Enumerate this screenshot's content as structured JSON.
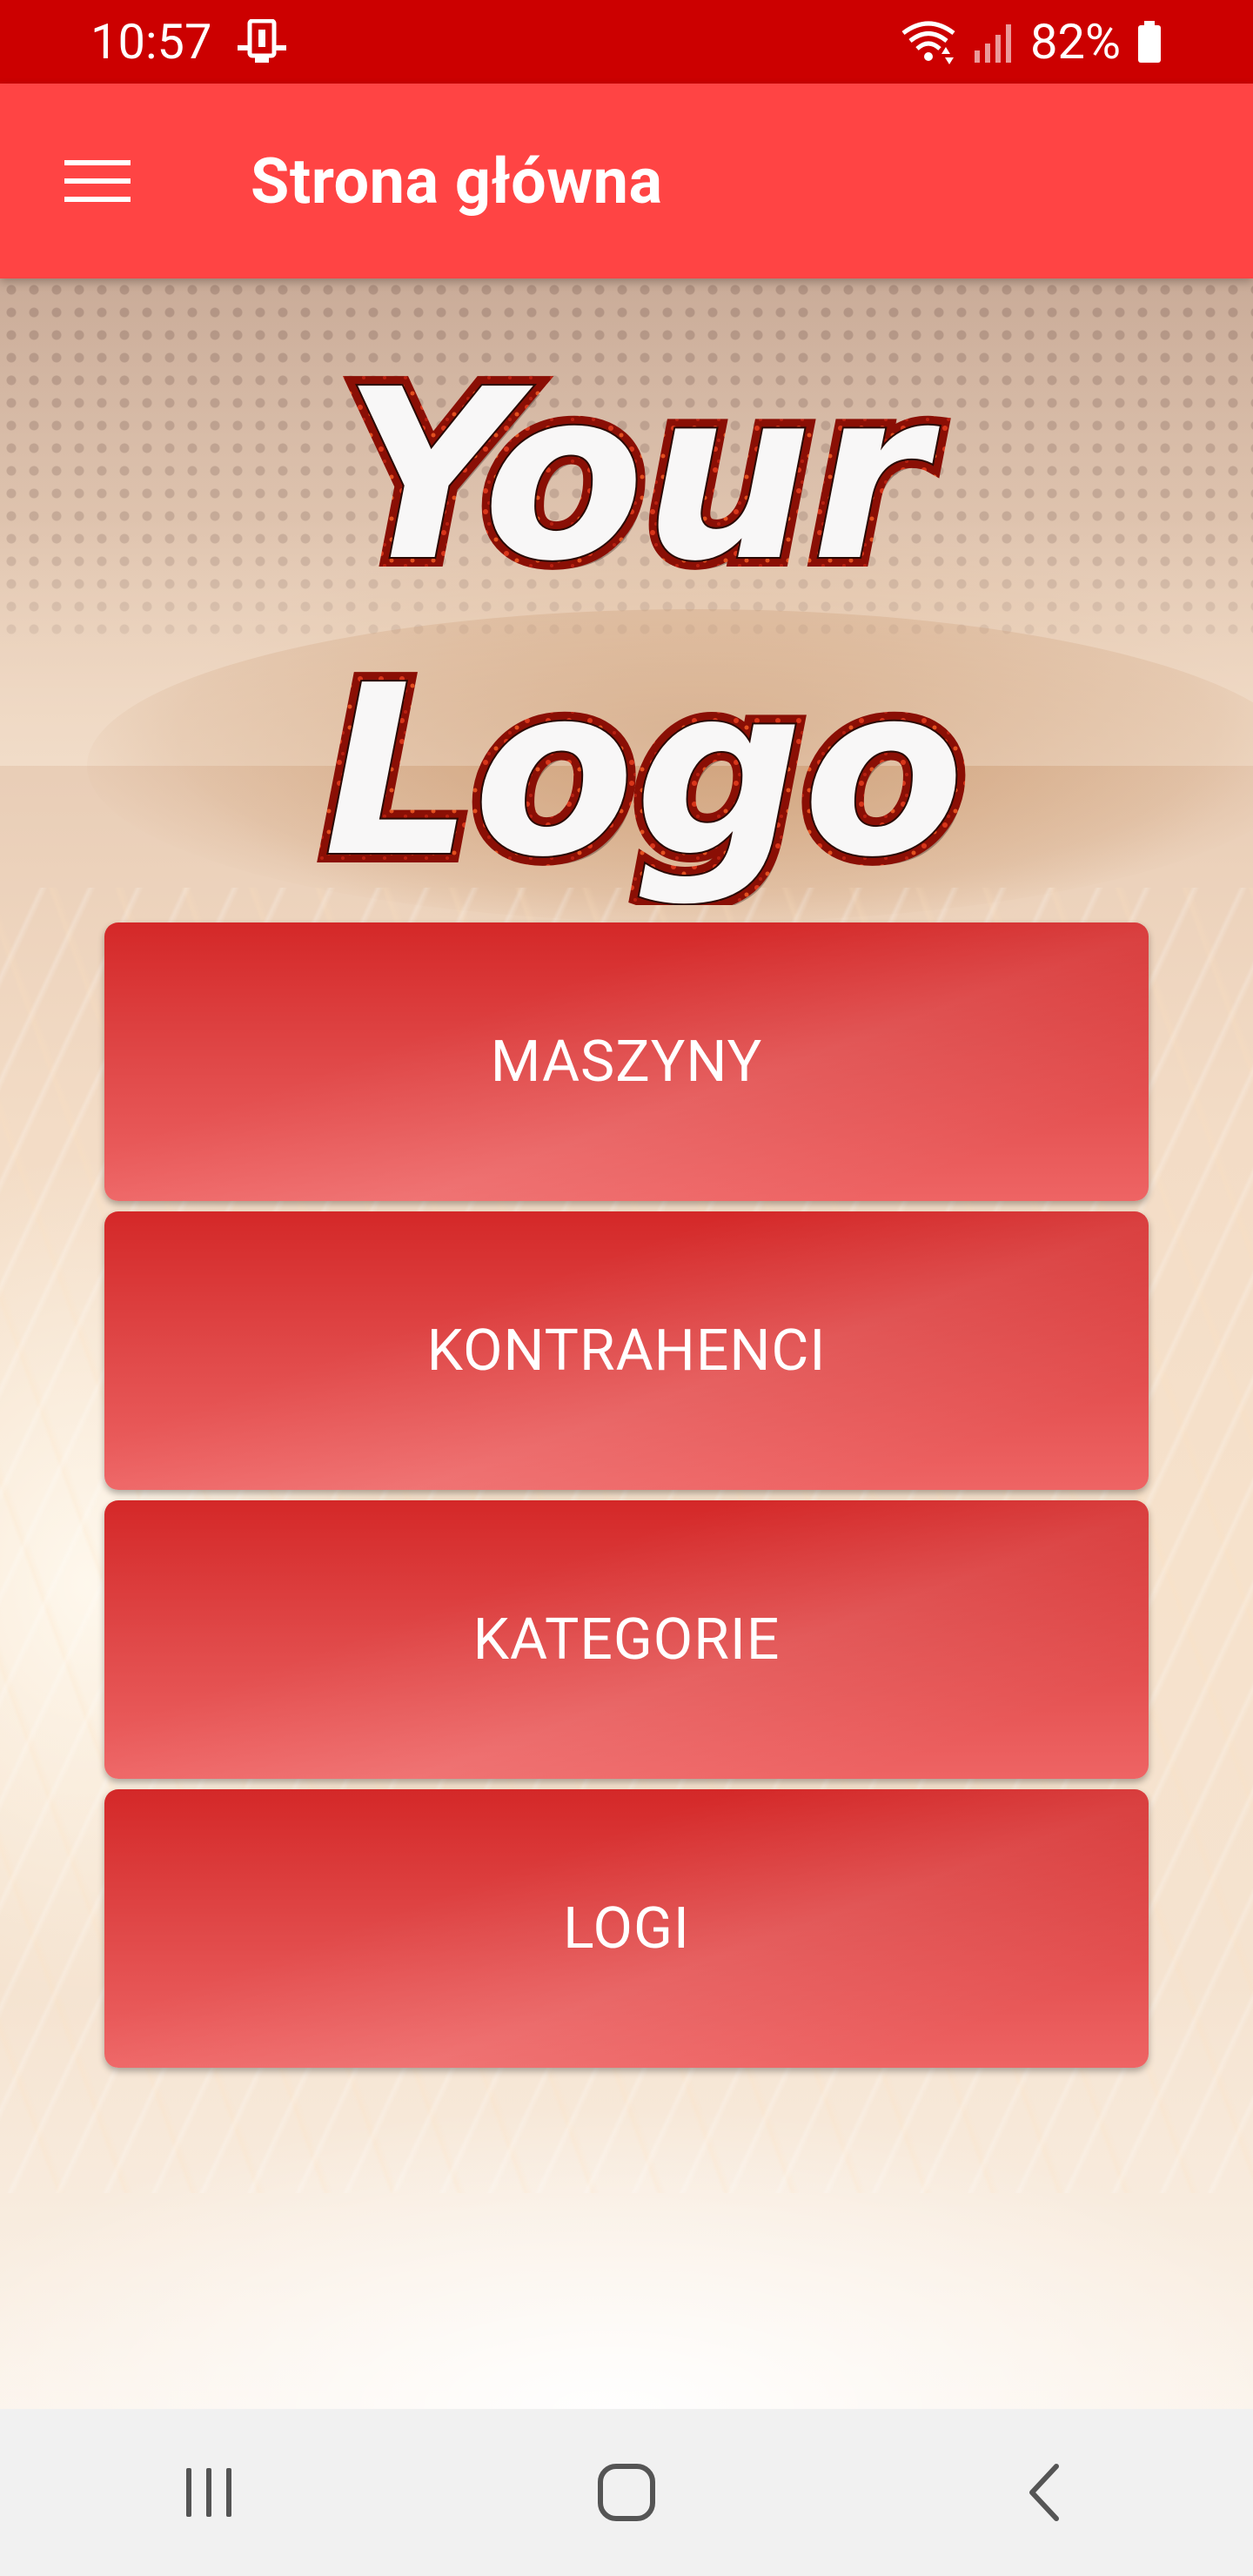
{
  "status_bar": {
    "time": "10:57",
    "battery": "82%",
    "icons": [
      "notification-device-icon",
      "wifi-icon",
      "signal-icon",
      "battery-icon"
    ],
    "color": "#cc0000"
  },
  "app_bar": {
    "title": "Strona główna",
    "menu_icon": "hamburger-menu-icon",
    "color": "#ff4444"
  },
  "logo": {
    "line1": "Your",
    "line2": "Logo"
  },
  "menu": {
    "items": [
      {
        "label": "MASZYNY"
      },
      {
        "label": "KONTRAHENCI"
      },
      {
        "label": "KATEGORIE"
      },
      {
        "label": "LOGI"
      }
    ],
    "button_color": "#e04848"
  },
  "nav_bar": {
    "icons": [
      "recent-apps-icon",
      "home-icon",
      "back-icon"
    ]
  }
}
